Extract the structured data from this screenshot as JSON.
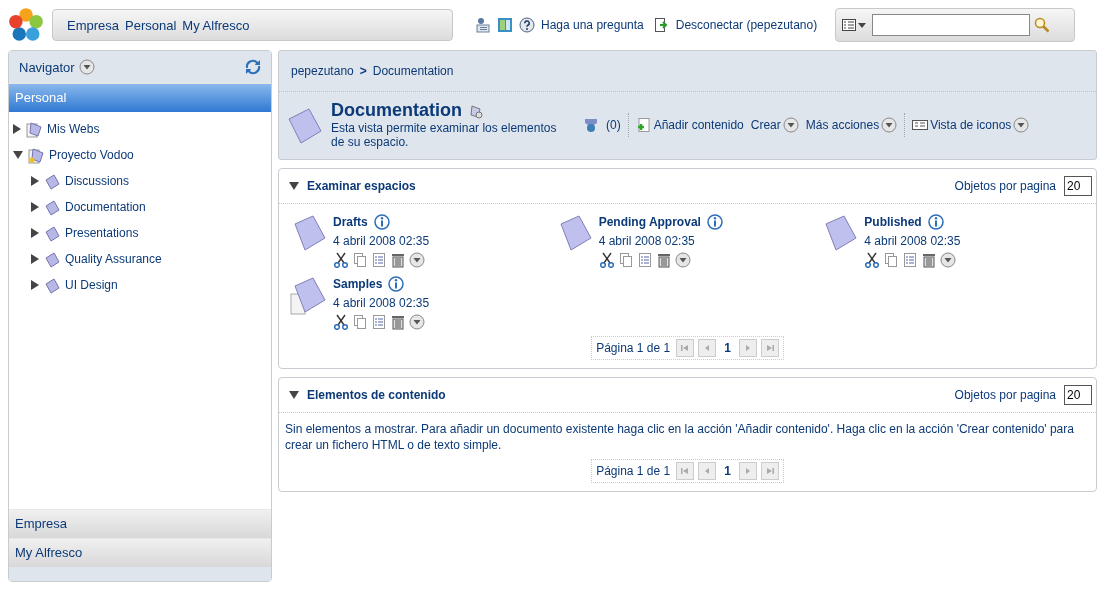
{
  "header": {
    "menu": [
      "Empresa",
      "Personal",
      "My Alfresco"
    ],
    "help_link": "Haga una pregunta",
    "logout_link": "Desconectar (pepezutano)"
  },
  "navigator": {
    "title": "Navigator",
    "sections": [
      {
        "label": "Personal",
        "selected": true
      },
      {
        "label": "Empresa",
        "selected": false
      },
      {
        "label": "My Alfresco",
        "selected": false
      }
    ],
    "tree": [
      {
        "label": "Mis Webs",
        "expanded": false
      },
      {
        "label": "Proyecto Vodoo",
        "expanded": true,
        "children": [
          {
            "label": "Discussions",
            "expanded": false
          },
          {
            "label": "Documentation",
            "expanded": false
          },
          {
            "label": "Presentations",
            "expanded": false
          },
          {
            "label": "Quality Assurance",
            "expanded": false
          },
          {
            "label": "UI Design",
            "expanded": false
          }
        ]
      }
    ]
  },
  "breadcrumb": {
    "items": [
      "pepezutano",
      "Documentation"
    ],
    "separator": ">"
  },
  "space": {
    "title": "Documentation",
    "description": "Esta vista permite examinar los elementos de su espacio.",
    "discussion_count": "(0)",
    "add_content": "Añadir contenido",
    "create": "Crear",
    "more_actions": "Más acciones",
    "view": "Vista de iconos"
  },
  "browse_spaces": {
    "title": "Examinar espacios",
    "per_page_label": "Objetos por pagina",
    "per_page": "20",
    "spaces": [
      {
        "name": "Drafts",
        "date": "4 abril 2008 02:35"
      },
      {
        "name": "Pending Approval",
        "date": "4 abril 2008 02:35"
      },
      {
        "name": "Published",
        "date": "4 abril 2008 02:35"
      },
      {
        "name": "Samples",
        "date": "4 abril 2008 02:35"
      }
    ],
    "pager": {
      "label": "Página 1 de 1",
      "current": "1"
    }
  },
  "content_items": {
    "title": "Elementos de contenido",
    "per_page_label": "Objetos por pagina",
    "per_page": "20",
    "message": "Sin elementos a mostrar. Para añadir un documento existente haga clic en la acción 'Añadir contenido'. Haga clic en la acción 'Crear contenido' para crear un fichero HTML o de texto simple.",
    "pager": {
      "label": "Página 1 de 1",
      "current": "1"
    }
  }
}
